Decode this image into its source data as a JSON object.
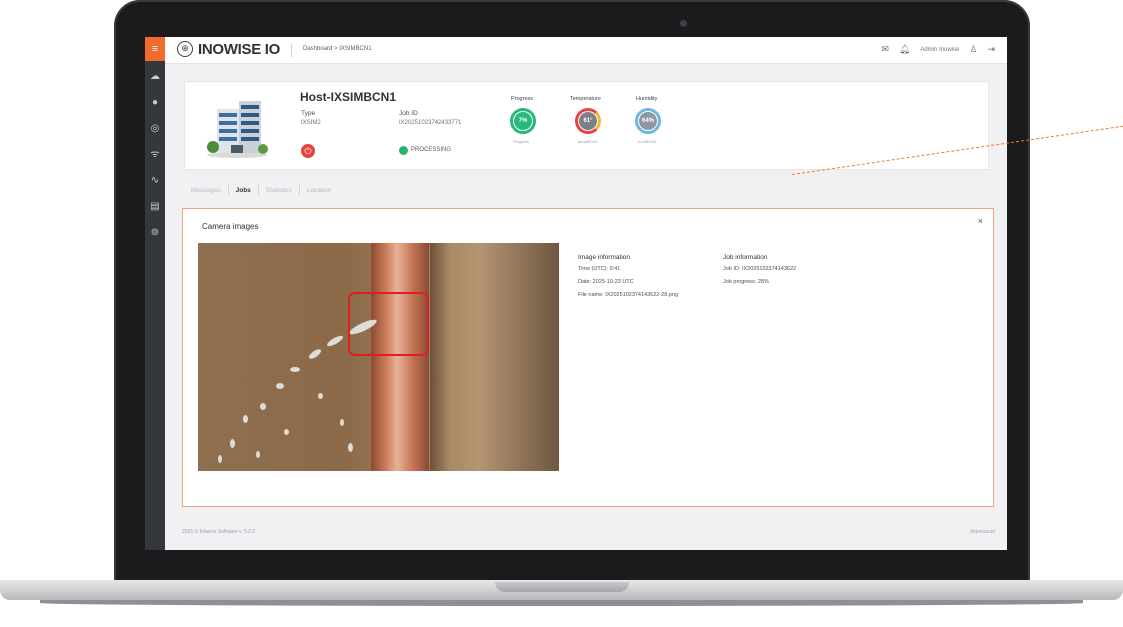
{
  "topbar": {
    "brand": "INOWISE IO",
    "breadcrumb": "Dashboard > IXSIMBCN1",
    "user_name": "Admin Inowise"
  },
  "sidebar": {
    "icons": [
      "menu-icon",
      "cloud-icon",
      "dashboard-icon",
      "target-icon",
      "wifi-icon",
      "activity-icon",
      "server-icon",
      "map-pin-icon"
    ]
  },
  "host": {
    "title": "Host-IXSIMBCN1",
    "type_label": "Type",
    "type_value": "IXSIM2",
    "job_label": "Job ID",
    "job_value": "IX20251023742433771",
    "status": "PROCESSING",
    "status_color": "#25b46e"
  },
  "metrics": [
    {
      "title": "Progress",
      "value": "7%",
      "sub": "Progress",
      "color": "#27b97a"
    },
    {
      "title": "Temperature",
      "value": "61°",
      "sub": "tempBCN1",
      "color": "#e8433a"
    },
    {
      "title": "Humidity",
      "value": "64%",
      "sub": "humBCN1",
      "color": "#8e96a0"
    }
  ],
  "tabs": [
    "Messages",
    "Jobs",
    "Statistics",
    "Location"
  ],
  "active_tab": "Jobs",
  "panel": {
    "title": "Camera images",
    "close": "×",
    "image_info": {
      "heading": "Image information",
      "time": "Time (UTC): 9:41",
      "date": "Date: 2025-10-23 UTC",
      "file": "File name: IX2025102374143622-28.png"
    },
    "job_info": {
      "heading": "Job information",
      "job_id": "Job ID: IX2025102374143622",
      "job_progress": "Job progress: 28%"
    }
  },
  "footer": {
    "copyright": "2025 © Inowise Software v. 5.2.2",
    "impressum": "Impressum"
  },
  "accent_color": "#f36b2c"
}
